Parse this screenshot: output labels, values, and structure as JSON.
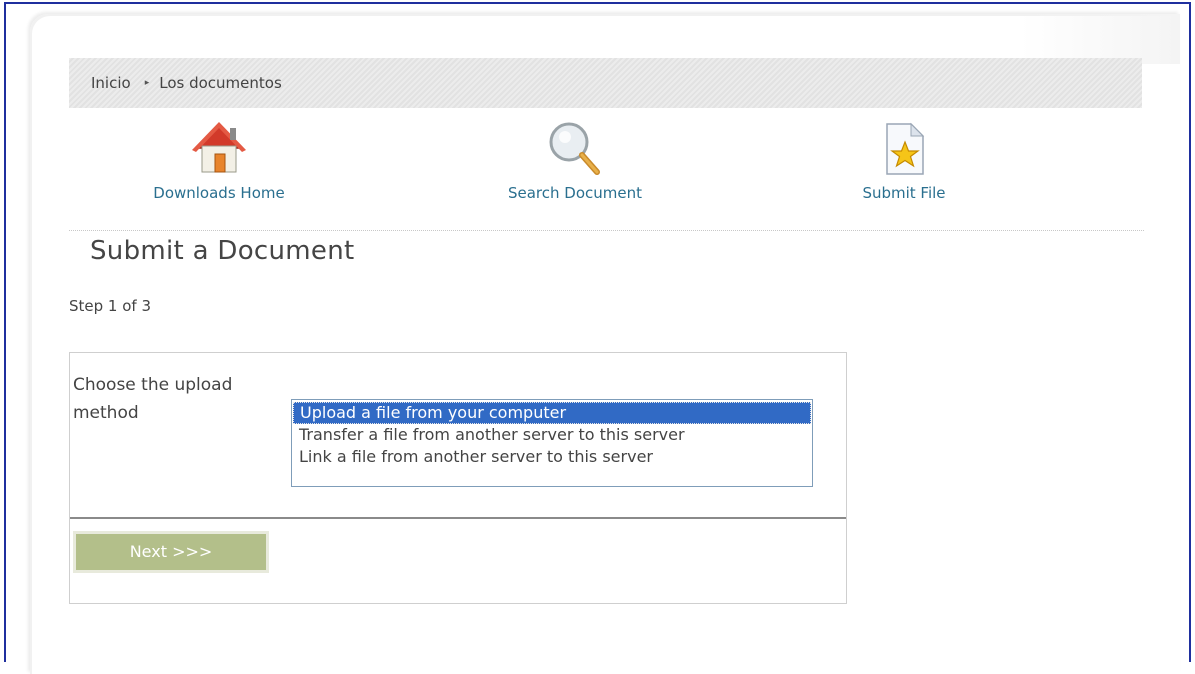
{
  "breadcrumb": {
    "home": "Inicio",
    "separator": "▸",
    "current": "Los documentos"
  },
  "toolbar": {
    "downloads_home": {
      "label": "Downloads Home",
      "icon": "house-icon"
    },
    "search_document": {
      "label": "Search Document",
      "icon": "magnifier-icon"
    },
    "submit_file": {
      "label": "Submit File",
      "icon": "star-document-icon"
    }
  },
  "page": {
    "title": "Submit a Document",
    "step": "Step 1 of 3"
  },
  "form": {
    "label": "Choose the upload method",
    "options": [
      "Upload a file from your computer",
      "Transfer a file from another server to this server",
      "Link a file from another server to this server"
    ],
    "selected_option": "Upload a file from your computer",
    "next_label": "Next >>>"
  },
  "colors": {
    "link": "#2a6f8f",
    "selection": "#316ac5",
    "next_button": "#b3bf8a",
    "frame_border": "#1f2f9e"
  }
}
